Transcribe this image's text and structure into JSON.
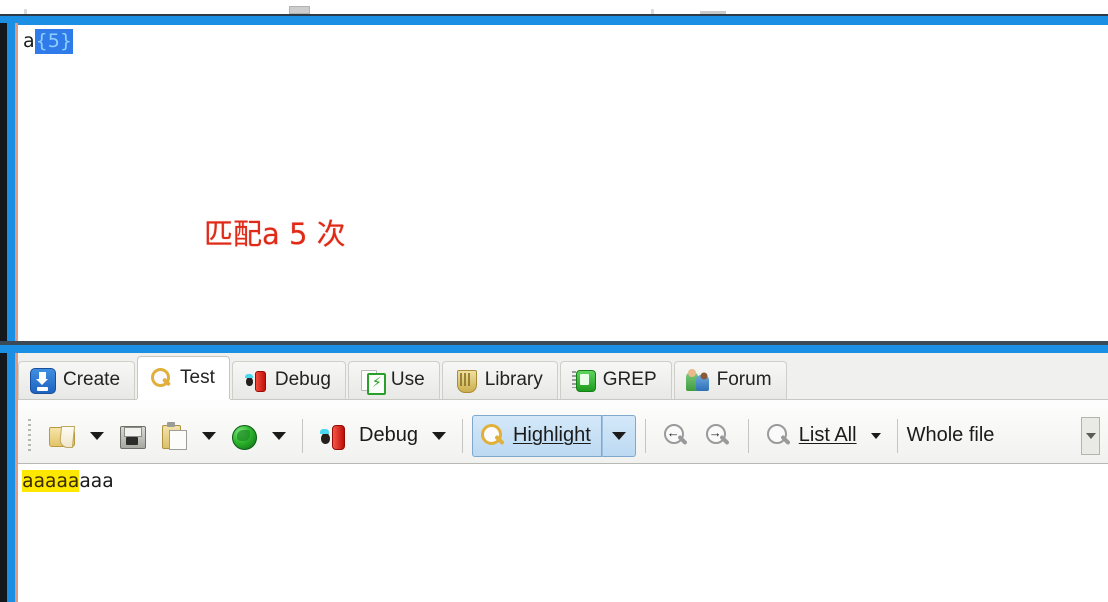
{
  "window": {
    "accent_blue": "#1a8fe3",
    "border_salmon": "#e09a82"
  },
  "regex_editor": {
    "literal": "a",
    "selected_quantifier": "{5}",
    "selection_color": "#2f7bea",
    "annotation": "匹配a 5 次",
    "annotation_color": "#e02a18"
  },
  "tabs": [
    {
      "label": "Create",
      "icon": "create-icon",
      "active": false
    },
    {
      "label": "Test",
      "icon": "magnifier-icon",
      "active": true
    },
    {
      "label": "Debug",
      "icon": "bug-debug-icon",
      "active": false
    },
    {
      "label": "Use",
      "icon": "use-page-icon",
      "active": false
    },
    {
      "label": "Library",
      "icon": "library-icon",
      "active": false
    },
    {
      "label": "GREP",
      "icon": "grep-icon",
      "active": false
    },
    {
      "label": "Forum",
      "icon": "forum-icon",
      "active": false
    }
  ],
  "toolbar": {
    "open_label": "",
    "save_label": "",
    "paste_label": "",
    "globe_label": "",
    "debug_label": "Debug",
    "highlight_label": "Highlight",
    "highlight_selected": true,
    "highlight_bg": "#c9e0f5",
    "find_prev_glyph": "←",
    "find_next_glyph": "→",
    "list_all_label": "List All",
    "scope_label": "Whole file"
  },
  "test_subject": {
    "highlighted_text": "aaaaa",
    "remaining_text": "aaa",
    "full_text": "aaaaaaaa",
    "match_count": 1,
    "highlight_color": "#ffe800"
  }
}
